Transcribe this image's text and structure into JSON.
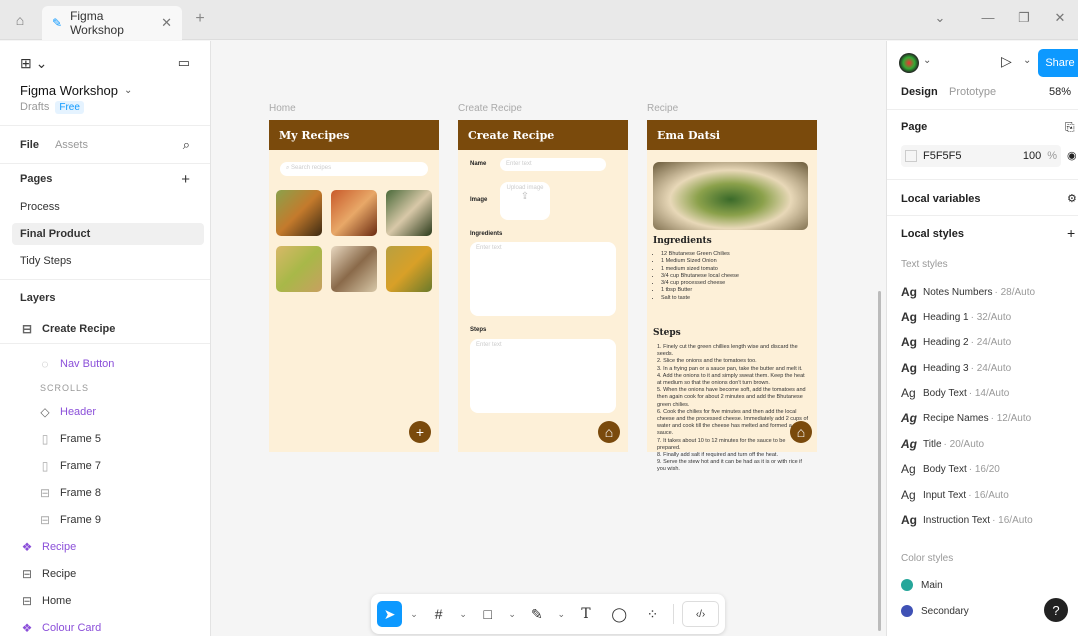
{
  "titlebar": {
    "tab_title": "Figma Workshop"
  },
  "left": {
    "file_name": "Figma Workshop",
    "drafts": "Drafts",
    "plan": "Free",
    "tabs": {
      "file": "File",
      "assets": "Assets"
    },
    "pages_title": "Pages",
    "pages": [
      {
        "label": "Process"
      },
      {
        "label": "Final Product"
      },
      {
        "label": "Tidy Steps"
      }
    ],
    "layers_title": "Layers",
    "layers": [
      {
        "label": "Create Recipe",
        "icon": "frame-grid-icon"
      },
      {
        "label": "Nav Button",
        "icon": "component-instance-icon"
      },
      {
        "label": "SCROLLS",
        "icon": ""
      },
      {
        "label": "Header",
        "icon": "diamond-icon"
      },
      {
        "label": "Frame 5",
        "icon": "vertical-frame-icon"
      },
      {
        "label": "Frame 7",
        "icon": "vertical-frame-icon"
      },
      {
        "label": "Frame 8",
        "icon": "frame-grid-icon"
      },
      {
        "label": "Frame 9",
        "icon": "frame-grid-icon"
      },
      {
        "label": "Recipe",
        "icon": "component-icon"
      },
      {
        "label": "Recipe",
        "icon": "frame-grid-icon"
      },
      {
        "label": "Home",
        "icon": "frame-grid-icon"
      },
      {
        "label": "Colour Card",
        "icon": "component-icon"
      }
    ]
  },
  "canvas": {
    "frames": {
      "home": {
        "label": "Home",
        "title": "My Recipes",
        "search_placeholder": "Search recipes"
      },
      "create": {
        "label": "Create Recipe",
        "title": "Create Recipe",
        "name_label": "Name",
        "name_placeholder": "Enter text",
        "image_label": "Image",
        "image_placeholder": "Upload image",
        "ingredients_label": "Ingredients",
        "ingredients_placeholder": "Enter text",
        "steps_label": "Steps",
        "steps_placeholder": "Enter text"
      },
      "recipe": {
        "label": "Recipe",
        "title": "Ema Datsi",
        "ingredients_title": "Ingredients",
        "ingredients": [
          "12 Bhutanese Green Chilies",
          "1 Medium Sized Onion",
          "1 medium sized tomato",
          "3/4 cup Bhutanese local cheese",
          "3/4 cup processed cheese",
          "1 tbsp Butter",
          "Salt to taste"
        ],
        "steps_title": "Steps",
        "steps": [
          "1. Finely cut the green chillies length wise and discard the seeds.",
          "2. Slice the onions and the tomatoes too.",
          "3. In a frying pan or a sauce pan, take the butter and melt it.",
          "4. Add the onions to it and simply sweat them. Keep the heat at medium so that the onions don't turn brown.",
          "5. When the onions have become soft, add the tomatoes and then again cook for about 2 minutes and add the Bhutanese green chilies.",
          "6. Cook the chilies for five minutes and then add the local cheese and the processed cheese. Immediately add 2 cups of water and cook till the cheese has melted and formed a nice sauce.",
          "7. It takes about 10 to 12 minutes for the sauce to be prepared.",
          "8. Finally add salt if required and turn off the heat.",
          "9. Serve the stew hot and it can be had as it is or with rice if you wish."
        ]
      }
    }
  },
  "right": {
    "share": "Share",
    "tabs": {
      "design": "Design",
      "prototype": "Prototype"
    },
    "zoom": "58%",
    "page_title": "Page",
    "page_color": "F5F5F5",
    "page_opacity": "100",
    "page_opacity_unit": "%",
    "local_variables": "Local variables",
    "local_styles": "Local styles",
    "text_styles_title": "Text styles",
    "text_styles": [
      {
        "name": "Notes Numbers",
        "spec": "· 28/Auto"
      },
      {
        "name": "Heading 1",
        "spec": "· 32/Auto"
      },
      {
        "name": "Heading 2",
        "spec": "· 24/Auto"
      },
      {
        "name": "Heading 3",
        "spec": "· 24/Auto"
      },
      {
        "name": "Body Text",
        "spec": "· 14/Auto"
      },
      {
        "name": "Recipe Names",
        "spec": "· 12/Auto"
      },
      {
        "name": "Title",
        "spec": "· 20/Auto"
      },
      {
        "name": "Body Text",
        "spec": "· 16/20"
      },
      {
        "name": "Input Text",
        "spec": "· 16/Auto"
      },
      {
        "name": "Instruction Text",
        "spec": "· 16/Auto"
      }
    ],
    "ag": "Ag",
    "color_styles_title": "Color styles",
    "color_styles": [
      {
        "name": "Main",
        "color": "#26a69a"
      },
      {
        "name": "Secondary",
        "color": "#3f51b5"
      }
    ]
  },
  "colors": {
    "accent": "#0d99ff",
    "brand_brown": "#7a4a0c",
    "frame_bg": "#fdf0d8"
  }
}
